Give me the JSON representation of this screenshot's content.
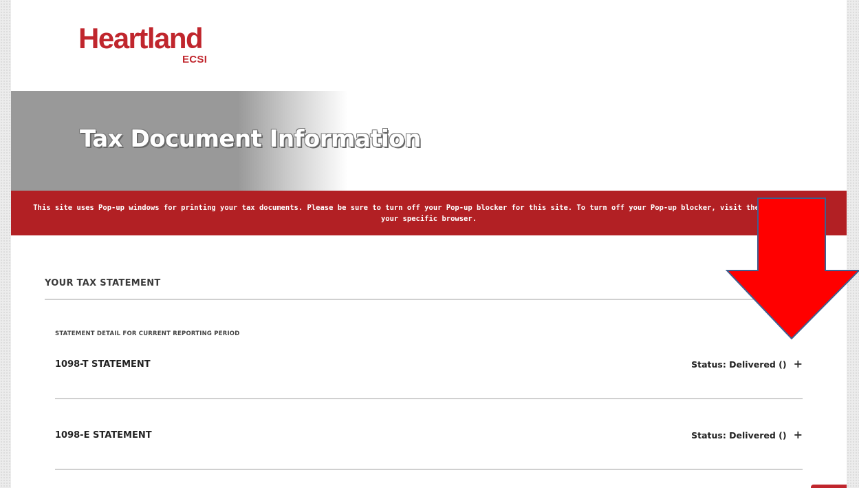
{
  "brand": {
    "name": "Heartland",
    "sub": "ECSI",
    "color": "#c0262d"
  },
  "hero": {
    "title": "Tax Document Information"
  },
  "banner": {
    "text": "This site uses Pop-up windows for printing your tax documents. Please be sure to turn off your Pop-up blocker for this site. To turn off your Pop-up blocker, visit the Tools menu for your specific browser.",
    "color": "#b22024"
  },
  "section": {
    "heading": "YOUR TAX STATEMENT",
    "subheading": "STATEMENT DETAIL FOR CURRENT REPORTING PERIOD"
  },
  "statements": [
    {
      "name": "1098-T STATEMENT",
      "status": "Status: Delivered ()",
      "expand_icon": "plus-icon"
    },
    {
      "name": "1098-E STATEMENT",
      "status": "Status: Delivered ()",
      "expand_icon": "plus-icon"
    }
  ],
  "overlay": {
    "arrow_icon": "down-arrow-icon",
    "arrow_color": "#ff0000"
  }
}
